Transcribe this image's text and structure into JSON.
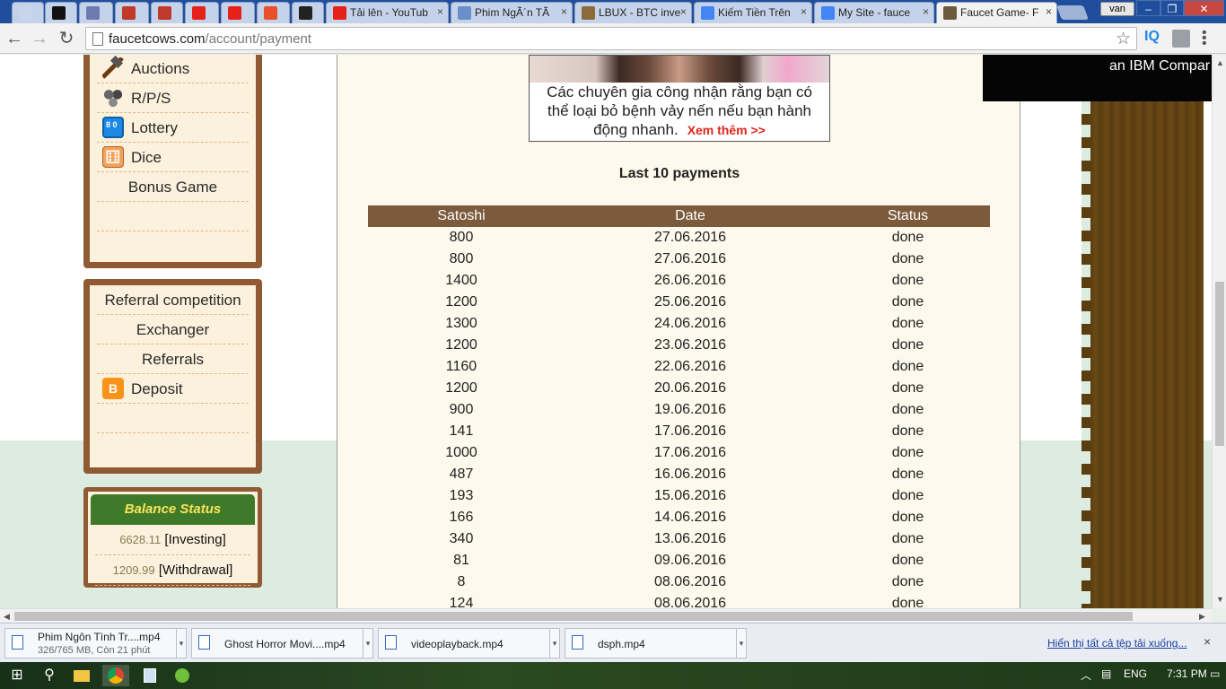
{
  "browser": {
    "tabs": [
      {
        "label": "",
        "color": "#c9d5ea"
      },
      {
        "label": "",
        "color": "#111111"
      },
      {
        "label": "",
        "color": "#6c7bb0"
      },
      {
        "label": "",
        "color": "#c0392b"
      },
      {
        "label": "",
        "color": "#c0392b"
      },
      {
        "label": "",
        "color": "#e62117"
      },
      {
        "label": "",
        "color": "#e62117"
      },
      {
        "label": "",
        "color": "#e8502a"
      },
      {
        "label": "",
        "color": "#222222"
      },
      {
        "label": "Tải lên - YouTub",
        "color": "#e62117"
      },
      {
        "label": "Phim NgÃ´n TÃ",
        "color": "#6a8fc8"
      },
      {
        "label": "LBUX - BTC inve",
        "color": "#8b6b3a"
      },
      {
        "label": "Kiếm Tiền Trên",
        "color": "#4285f4"
      },
      {
        "label": "My Site - fauce",
        "color": "#4285f4"
      },
      {
        "label": "Faucet Game- F",
        "color": "#6d5a3c"
      }
    ],
    "user_label": "van",
    "url_host": "faucetcows.com",
    "url_path": "/account/payment",
    "extension_label": "IQ"
  },
  "sidebar": {
    "games": [
      {
        "label": "Auctions",
        "icon": "hammer-icon"
      },
      {
        "label": "R/P/S",
        "icon": "rps-icon"
      },
      {
        "label": "Lottery",
        "icon": "lottery-icon"
      },
      {
        "label": "Dice",
        "icon": "dice-icon"
      },
      {
        "label": "Bonus Game",
        "icon": ""
      }
    ],
    "account": [
      {
        "label": "Referral competition",
        "icon": ""
      },
      {
        "label": "Exchanger",
        "icon": ""
      },
      {
        "label": "Referrals",
        "icon": ""
      },
      {
        "label": "Deposit",
        "icon": "bitcoin-icon"
      }
    ],
    "balance": {
      "title": "Balance Status",
      "investing_value": "6628.11",
      "investing_label": "[Investing]",
      "withdrawal_value": "1209.99",
      "withdrawal_label": "[Withdrawal]"
    }
  },
  "ad": {
    "line1": "Các chuyên gia công nhận rằng bạn có",
    "line2": "thể loại bỏ bệnh vảy nến nếu bạn hành",
    "line3": "động nhanh.",
    "more": "Xem thêm >>"
  },
  "right_ad": {
    "text": "an IBM Compar"
  },
  "payments": {
    "title": "Last 10 payments",
    "columns": [
      "Satoshi",
      "Date",
      "Status"
    ],
    "rows": [
      [
        "800",
        "27.06.2016",
        "done"
      ],
      [
        "800",
        "27.06.2016",
        "done"
      ],
      [
        "1400",
        "26.06.2016",
        "done"
      ],
      [
        "1200",
        "25.06.2016",
        "done"
      ],
      [
        "1300",
        "24.06.2016",
        "done"
      ],
      [
        "1200",
        "23.06.2016",
        "done"
      ],
      [
        "1160",
        "22.06.2016",
        "done"
      ],
      [
        "1200",
        "20.06.2016",
        "done"
      ],
      [
        "900",
        "19.06.2016",
        "done"
      ],
      [
        "141",
        "17.06.2016",
        "done"
      ],
      [
        "1000",
        "17.06.2016",
        "done"
      ],
      [
        "487",
        "16.06.2016",
        "done"
      ],
      [
        "193",
        "15.06.2016",
        "done"
      ],
      [
        "166",
        "14.06.2016",
        "done"
      ],
      [
        "340",
        "13.06.2016",
        "done"
      ],
      [
        "81",
        "09.06.2016",
        "done"
      ],
      [
        "8",
        "08.06.2016",
        "done"
      ],
      [
        "124",
        "08.06.2016",
        "done"
      ]
    ]
  },
  "downloads": {
    "items": [
      {
        "name": "Phim Ngôn Tình Tr....mp4",
        "sub": "326/765 MB, Còn 21 phút"
      },
      {
        "name": "Ghost Horror Movi....mp4",
        "sub": ""
      },
      {
        "name": "videoplayback.mp4",
        "sub": ""
      },
      {
        "name": "dsph.mp4",
        "sub": ""
      }
    ],
    "show_all": "Hiển thị tất cả tệp tải xuống...",
    "close": "×"
  },
  "taskbar": {
    "language": "ENG",
    "time": "7:31 PM"
  }
}
